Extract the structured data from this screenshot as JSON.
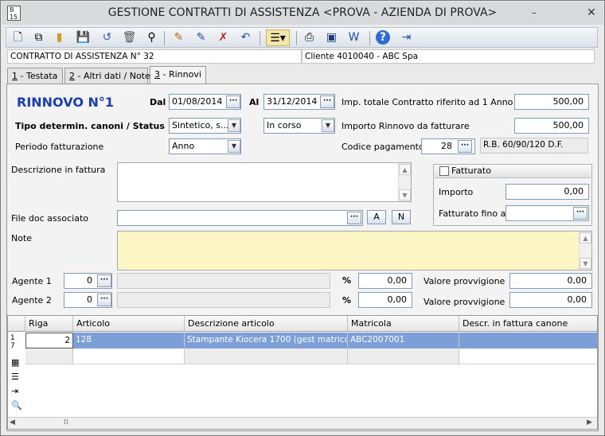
{
  "window": {
    "title": "GESTIONE CONTRATTI DI ASSISTENZA <PROVA - AZIENDA DI PROVA>",
    "logo_text": "15"
  },
  "toolbar": {
    "icons": [
      "new-document-icon",
      "copy-icon",
      "clipboard-icon",
      "save-icon",
      "undo-icon",
      "delete-icon",
      "binoculars-icon",
      "edit-pen-icon",
      "edit-arrow-icon",
      "edit-delete-icon",
      "edit-undo-icon",
      "list-menu-icon",
      "print-icon",
      "monitor-icon",
      "export-word-icon",
      "help-icon",
      "exit-icon"
    ]
  },
  "header": {
    "contract": "CONTRATTO DI ASSISTENZA N° 32",
    "client": "Cliente 4010040 - ABC Spa"
  },
  "tabs": [
    {
      "num": "1",
      "label": " - Testata"
    },
    {
      "num": "2",
      "label": " - Altri dati / Note"
    },
    {
      "num": "3",
      "label": " - Rinnovi"
    }
  ],
  "renewal": {
    "title": "RINNOVO N°1",
    "dal_label": "Dal",
    "dal_value": "01/08/2014",
    "al_label": "Al",
    "al_value": "31/12/2014",
    "imp_totale_label": "Imp. totale Contratto riferito ad 1 Anno",
    "imp_totale_value": "500,00",
    "tipo_label": "Tipo determin. canoni / Status",
    "tipo_value": "Sintetico, s...",
    "status_value": "In corso",
    "importo_rinnovo_label": "Importo Rinnovo da fatturare",
    "importo_rinnovo_value": "500,00",
    "periodo_label": "Periodo fatturazione",
    "periodo_value": "Anno",
    "codice_pag_label": "Codice pagamento",
    "codice_pag_value": "28",
    "codice_pag_desc": "R.B. 60/90/120 D.F.",
    "descr_label": "Descrizione in fattura",
    "file_label": "File doc associato",
    "file_btn_a": "A",
    "file_btn_n": "N",
    "note_label": "Note",
    "fatturato_label": "Fatturato",
    "importo_label": "Importo",
    "importo_value": "0,00",
    "fatturato_fino_label": "Fatturato fino al",
    "agente1_label": "Agente 1",
    "agente1_value": "0",
    "agente1_perc": "0,00",
    "agente1_prov_label": "Valore provvigione",
    "agente1_prov": "0,00",
    "agente2_label": "Agente 2",
    "agente2_value": "0",
    "agente2_perc": "0,00",
    "agente2_prov_label": "Valore provvigione",
    "agente2_prov": "0,00",
    "perc_symbol": "%"
  },
  "grid": {
    "columns": [
      "Riga",
      "Articolo",
      "Descrizione articolo",
      "Matricola",
      "Descr. in fattura canone"
    ],
    "rows": [
      {
        "riga": "2",
        "articolo": "128",
        "descrizione": "Stampante Kiocera 1700  (gest matricole)",
        "matricola": "ABC2007001",
        "descr_fattura": ""
      }
    ],
    "row_indicator": "1\n7",
    "side_icons": [
      "calc-icon",
      "list-icon",
      "insert-row-icon",
      "search-icon"
    ]
  }
}
